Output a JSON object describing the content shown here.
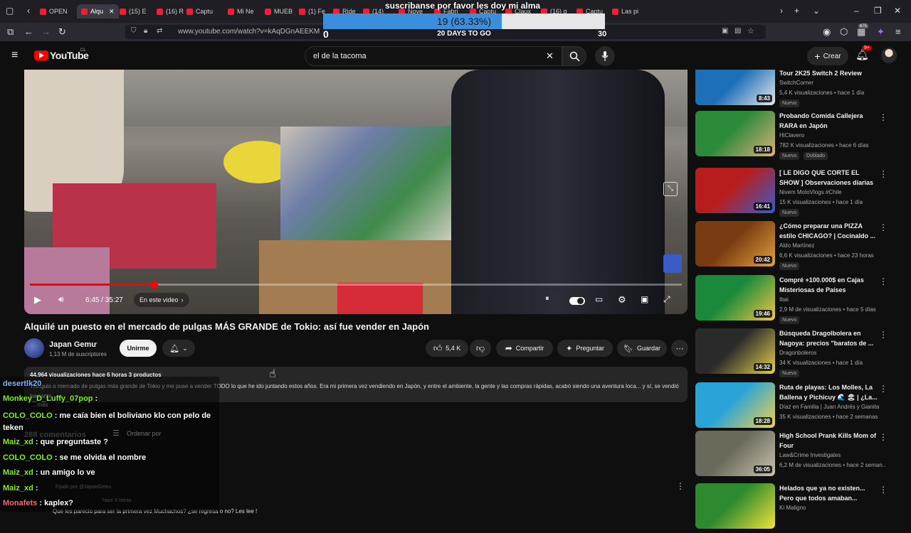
{
  "browser": {
    "tabs": [
      {
        "label": "OPEN"
      },
      {
        "label": "Alqu"
      },
      {
        "label": "(15) E"
      },
      {
        "label": "(16) R"
      },
      {
        "label": "Captu"
      },
      {
        "label": "Mi Ne"
      },
      {
        "label": "MUEB"
      },
      {
        "label": "(1) Fe"
      },
      {
        "label": "Ride"
      },
      {
        "label": "(14)"
      },
      {
        "label": "Nove"
      },
      {
        "label": "Fabri"
      },
      {
        "label": "Captu"
      },
      {
        "label": "Claux"
      },
      {
        "label": "(16) g"
      },
      {
        "label": "Captu"
      },
      {
        "label": "Las pi"
      }
    ],
    "url": "www.youtube.com/watch?v=kAqDGnAEEKM",
    "extension_badge": "675"
  },
  "overlay": {
    "title": "suscribanse por favor les doy mi alma",
    "progress_text": "19 (63.33%)",
    "progress_fraction": 0.6333,
    "days_label": "20 DAYS TO GO",
    "min": "0",
    "max": "30"
  },
  "youtube": {
    "logo_text": "YouTube",
    "country": "CL",
    "search_value": "el de la tacoma",
    "create_label": "Crear",
    "notif_count": "9+"
  },
  "player": {
    "time": "6:45 / 35:27",
    "chapter": "En este video",
    "progress_fraction": 0.19
  },
  "video": {
    "title": "Alquilé un puesto en el mercado de pulgas MÁS GRANDE de Tokio: así fue vender en Japón",
    "channel": "Japan Gemu",
    "subscribers": "1,13 M de suscriptores",
    "join_label": "Unirme",
    "likes": "5,4 K",
    "share_label": "Compartir",
    "ask_label": "Preguntar",
    "save_label": "Guardar",
    "meta": "44.964 visualizaciones  hace 6 horas  3 productos",
    "description": "Tianguis o mercado de pulgas más grande de Tokio y me puse a vender TODO lo que he ido juntando estos años. Era mi primera vez vendiendo en Japón, y entre el ambiente, la gente y las compras rápidas, acabó siendo una aventura loca... y sí, se vendió bastante.",
    "more_label": "...más",
    "comments_count": "288 comentarios",
    "sort_label": "Ordenar por",
    "pinned_label": "Fijado por @JapanGemu",
    "comment_time": "hace 6 horas",
    "comment_text": "Que les parecio para ser la primera vez Muchachos? ¿se regresa o no? Les lee !"
  },
  "chat": [
    {
      "user": "desertlk20",
      "text": "",
      "color": "#7db6ff"
    },
    {
      "user": "Monkey_D_Luffy_07pop",
      "text": ":",
      "color": "#7cfc00"
    },
    {
      "user": "COLO_COLO",
      "text": ": me caía bien el boliviano klo con pelo de teken",
      "color": "#7cfc00"
    },
    {
      "user": "Maiz_xd",
      "text": ": que preguntaste ?",
      "color": "#7cfc00"
    },
    {
      "user": "COLO_COLO",
      "text": ": se me olvida el nombre",
      "color": "#7cfc00"
    },
    {
      "user": "Maiz_xd",
      "text": ": un amigo lo ve",
      "color": "#7cfc00"
    },
    {
      "user": "Maiz_xd",
      "text": ":",
      "color": "#7cfc00"
    },
    {
      "user": "Monafets",
      "text": ": kaplex?",
      "color": "#ff6a6a"
    }
  ],
  "recommendations": [
    {
      "title": "Tour 2K25 Switch 2 Review",
      "channel": "SwitchCorner",
      "meta": "5,4 K visualizaciones • hace 1 día",
      "badge": "Nuevo",
      "duration": "8:43",
      "colors": [
        "#1d6fb8",
        "#e8e8e8"
      ]
    },
    {
      "title": "Probando Comida Callejera RARA en Japón",
      "channel": "HiClavero",
      "meta": "782 K visualizaciones • hace 6 días",
      "badge": "Nuevo",
      "badge2": "Doblado",
      "duration": "18:18",
      "colors": [
        "#2c8a3a",
        "#d9b27a"
      ]
    },
    {
      "title": "[ LE DIGO QUE CORTE EL SHOW ] Observaciones diarias 76 ...",
      "channel": "Nivem MotoVlogs #Chile",
      "meta": "15 K visualizaciones • hace 1 día",
      "badge": "Nuevo",
      "duration": "16:41",
      "colors": [
        "#b81d1d",
        "#3a5cc7"
      ]
    },
    {
      "title": "¿Cómo preparar una PIZZA estilo CHICAGO? | Cocinaldo ...",
      "channel": "Aldo Martínez",
      "meta": "6,6 K visualizaciones • hace 23 horas",
      "badge": "Nuevo",
      "duration": "20:42",
      "colors": [
        "#7a3a12",
        "#e0a23a"
      ]
    },
    {
      "title": "Compré +100.000$ en Cajas Misteriosas de Países",
      "channel": "Ibai",
      "meta": "2,9 M de visualizaciones • hace 5 días",
      "badge": "Nuevo",
      "duration": "19:46",
      "colors": [
        "#1a8a3a",
        "#f2c744"
      ]
    },
    {
      "title": "Búsqueda Dragolbolera en Nagoya: precios \"baratos de ...",
      "channel": "Dragonboleros",
      "meta": "34 K visualizaciones • hace 1 día",
      "badge": "Nuevo",
      "duration": "14:32",
      "colors": [
        "#2a2a2a",
        "#e6d24a"
      ]
    },
    {
      "title": "Ruta de playas: Los Molles, La Ballena y Pichicuy 🌊 🏖 | ¿La...",
      "channel": "Díaz en Familia | Juan Andrés y Gianita",
      "meta": "35 K visualizaciones • hace 2 semanas",
      "badge": "",
      "duration": "18:28",
      "colors": [
        "#2aa4d8",
        "#f2d24a"
      ]
    },
    {
      "title": "High School Prank Kills Mom of Four",
      "channel": "Law&Crime Investigates",
      "meta": "6,2 M de visualizaciones • hace 2 seman...",
      "badge": "",
      "duration": "36:05",
      "colors": [
        "#6a6a5a",
        "#c9c2b0"
      ]
    },
    {
      "title": "Helados que ya no existen... Pero que todos amaban...",
      "channel": "Ki Maligno",
      "meta": "",
      "badge": "",
      "duration": "",
      "colors": [
        "#2e8a2e",
        "#f2e23a"
      ]
    }
  ]
}
